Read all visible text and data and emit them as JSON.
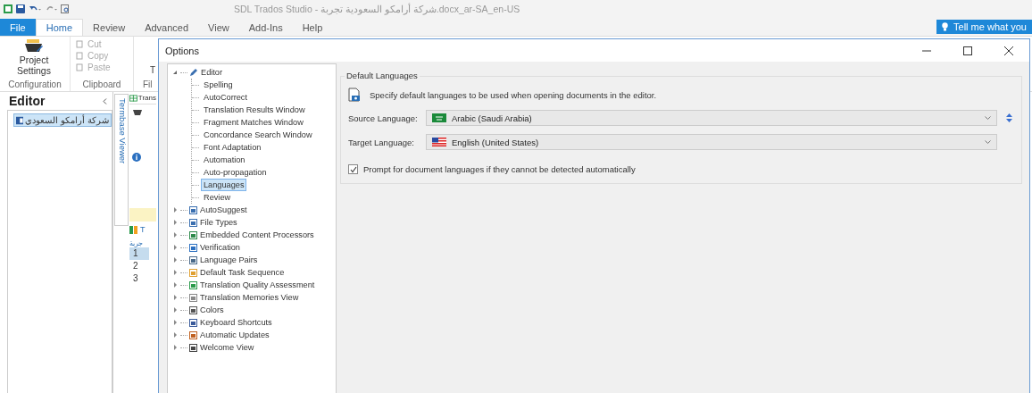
{
  "app_title_bar": {
    "title": "SDL Trados Studio - شركة أرامكو السعودية تجربة.docx_ar-SA_en-US"
  },
  "ribbon_tabs": [
    {
      "label": "File",
      "kind": "file",
      "selected": false
    },
    {
      "label": "Home",
      "kind": "tab",
      "selected": true
    },
    {
      "label": "Review",
      "kind": "tab",
      "selected": false
    },
    {
      "label": "Advanced",
      "kind": "tab",
      "selected": false
    },
    {
      "label": "View",
      "kind": "tab",
      "selected": false
    },
    {
      "label": "Add-Ins",
      "kind": "tab",
      "selected": false
    },
    {
      "label": "Help",
      "kind": "tab",
      "selected": false
    }
  ],
  "tell_me": {
    "label": "Tell me what you"
  },
  "ribbon": {
    "project_settings": "Project Settings",
    "clipboard_items": [
      {
        "label": "Cut",
        "disabled": true
      },
      {
        "label": "Copy",
        "disabled": true
      },
      {
        "label": "Paste",
        "disabled": true
      }
    ],
    "cut_off_button": "T",
    "group_labels": [
      "Configuration",
      "Clipboard",
      "Fil"
    ]
  },
  "editor_panel": {
    "title": "Editor",
    "items": [
      {
        "label": "شركة أرامكو السعودي",
        "selected": true
      }
    ]
  },
  "side_tab": "Termbase Viewer",
  "document_area": {
    "header": "Trans",
    "tab": "جربة",
    "label": "T",
    "rows": [
      {
        "number": "1",
        "selected": true
      },
      {
        "number": "2",
        "selected": false
      },
      {
        "number": "3",
        "selected": false
      }
    ]
  },
  "options_dialog": {
    "title": "Options",
    "tree": [
      {
        "label": "Editor",
        "expanded": true,
        "selected": false,
        "children": [
          {
            "label": "Spelling",
            "selected": false
          },
          {
            "label": "AutoCorrect",
            "selected": false
          },
          {
            "label": "Translation Results Window",
            "selected": false
          },
          {
            "label": "Fragment Matches Window",
            "selected": false
          },
          {
            "label": "Concordance Search Window",
            "selected": false
          },
          {
            "label": "Font Adaptation",
            "selected": false
          },
          {
            "label": "Automation",
            "selected": false
          },
          {
            "label": "Auto-propagation",
            "selected": false
          },
          {
            "label": "Languages",
            "selected": true
          },
          {
            "label": "Review",
            "selected": false
          }
        ]
      },
      {
        "label": "AutoSuggest",
        "expanded": false,
        "selected": false
      },
      {
        "label": "File Types",
        "expanded": false,
        "selected": false
      },
      {
        "label": "Embedded Content Processors",
        "expanded": false,
        "selected": false
      },
      {
        "label": "Verification",
        "expanded": false,
        "selected": false
      },
      {
        "label": "Language Pairs",
        "expanded": false,
        "selected": false
      },
      {
        "label": "Default Task Sequence",
        "expanded": false,
        "selected": false
      },
      {
        "label": "Translation Quality Assessment",
        "expanded": false,
        "selected": false
      },
      {
        "label": "Translation Memories View",
        "expanded": false,
        "selected": false
      },
      {
        "label": "Colors",
        "expanded": false,
        "selected": false
      },
      {
        "label": "Keyboard Shortcuts",
        "expanded": false,
        "selected": false
      },
      {
        "label": "Automatic Updates",
        "expanded": false,
        "selected": false
      },
      {
        "label": "Welcome View",
        "expanded": false,
        "selected": false
      }
    ],
    "group_title": "Default Languages",
    "description": "Specify default languages to be used when opening documents in the editor.",
    "source_language": {
      "label": "Source Language:",
      "value": "Arabic (Saudi Arabia)"
    },
    "target_language": {
      "label": "Target Language:",
      "value": "English (United States)"
    },
    "prompt_checkbox": {
      "label": "Prompt for document languages if they cannot be detected automatically",
      "checked": true
    }
  }
}
